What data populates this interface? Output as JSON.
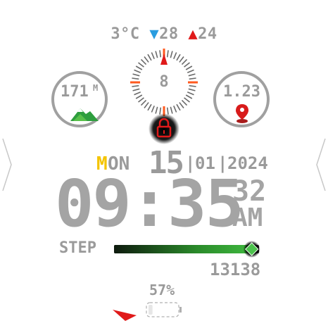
{
  "weather": {
    "current_temp": "3°C",
    "low_temp": "28",
    "high_temp": "24",
    "low_icon": "triangle-down-icon",
    "high_icon": "triangle-up-icon",
    "low_color": "#2a9de0",
    "high_color": "#e01a1a"
  },
  "altitude": {
    "value": "171",
    "unit": "M",
    "icon": "mountain-icon"
  },
  "dial": {
    "value": "8",
    "accent_color": "#ff5a1f"
  },
  "heart_rate": {
    "value": "1.23",
    "icon": "map-pin-icon"
  },
  "lock": {
    "icon": "padlock-icon",
    "color": "#e01a1a"
  },
  "date": {
    "day_first_letter": "M",
    "day_rest": "ON",
    "day_num": "15",
    "month": "01",
    "year": "2024"
  },
  "time": {
    "hours_minutes": "09:35",
    "seconds": "32",
    "ampm": "AM"
  },
  "steps": {
    "label": "STEP",
    "count": "13138",
    "progress_fraction": 0.95,
    "bar_color": "#3fb83f",
    "marker_color": "#4cc24c"
  },
  "battery": {
    "percent": "57%",
    "level_fraction": 0.57,
    "icon": "battery-icon"
  },
  "indicator": {
    "icon": "red-wedge-icon",
    "color": "#e01a1a"
  }
}
